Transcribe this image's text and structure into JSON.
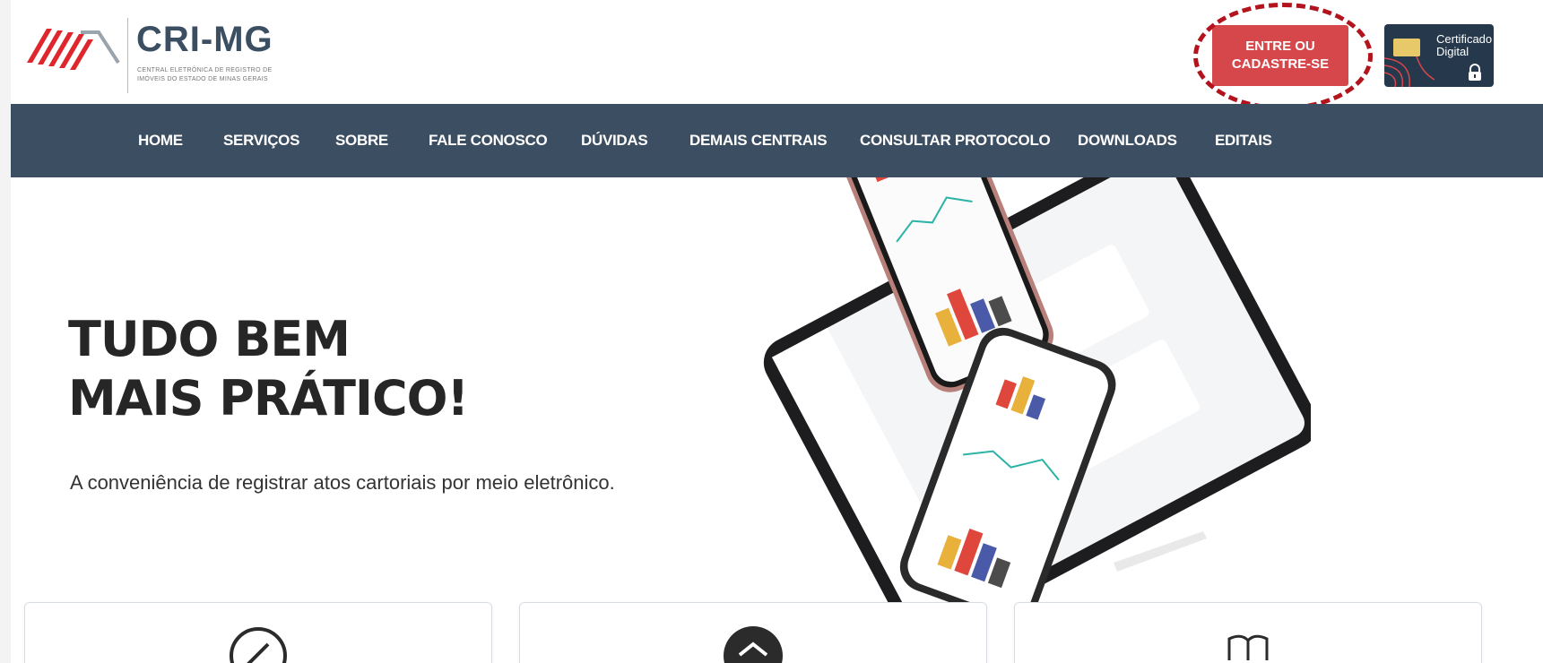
{
  "header": {
    "logo_title": "CRI-MG",
    "logo_subtitle": "Central Eletrônica de Registro de Imóveis do Estado de Minas Gerais",
    "login_button": "ENTRE OU CADASTRE-SE",
    "cert_button": "Certificado Digital"
  },
  "nav": {
    "items": [
      {
        "label": "HOME"
      },
      {
        "label": "SERVIÇOS"
      },
      {
        "label": "SOBRE"
      },
      {
        "label": "FALE CONOSCO"
      },
      {
        "label": "DÚVIDAS"
      },
      {
        "label": "DEMAIS CENTRAIS"
      },
      {
        "label": "CONSULTAR PROTOCOLO"
      },
      {
        "label": "DOWNLOADS"
      },
      {
        "label": "EDITAIS"
      }
    ]
  },
  "hero": {
    "title_line1": "TUDO BEM",
    "title_line2": "MAIS PRÁTICO!",
    "subtitle": "A conveniência de registrar atos cartoriais por meio eletrônico."
  },
  "cards": [
    {
      "icon": "gauge-icon"
    },
    {
      "icon": "house-layers-icon"
    },
    {
      "icon": "book-icon"
    }
  ],
  "colors": {
    "brand_red": "#d6474c",
    "nav_bg": "#3c4e61",
    "callout": "#b3131d"
  }
}
